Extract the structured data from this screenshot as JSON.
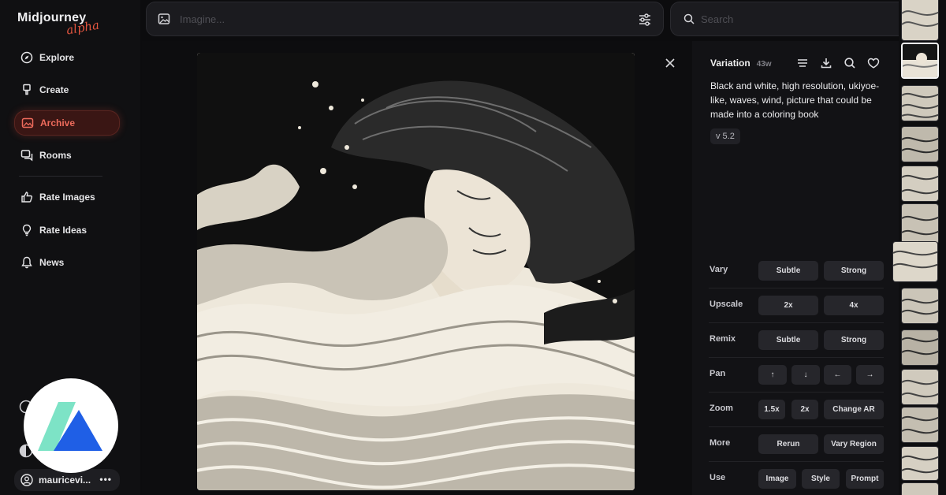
{
  "app": {
    "name": "Midjourney",
    "sub": "alpha"
  },
  "sidebar": {
    "items": [
      {
        "label": "Explore",
        "icon": "compass-icon"
      },
      {
        "label": "Create",
        "icon": "brush-icon"
      },
      {
        "label": "Archive",
        "icon": "image-icon",
        "active": true
      },
      {
        "label": "Rooms",
        "icon": "chat-icon"
      },
      {
        "label": "Rate Images",
        "icon": "thumbs-up-icon"
      },
      {
        "label": "Rate Ideas",
        "icon": "lightbulb-icon"
      },
      {
        "label": "News",
        "icon": "bell-icon"
      }
    ],
    "user": {
      "name": "mauricevi...",
      "more": "•••"
    }
  },
  "imagine": {
    "placeholder": "Imagine..."
  },
  "search": {
    "placeholder": "Search"
  },
  "panel": {
    "title": "Variation",
    "age": "43w",
    "prompt": "Black and white, high resolution, ukiyoe-like, waves, wind, picture that could be made into a coloring book",
    "version": "v 5.2",
    "actions": [
      {
        "label": "Vary",
        "buttons": [
          "Subtle",
          "Strong"
        ]
      },
      {
        "label": "Upscale",
        "buttons": [
          "2x",
          "4x"
        ]
      },
      {
        "label": "Remix",
        "buttons": [
          "Subtle",
          "Strong"
        ]
      },
      {
        "label": "Pan",
        "buttons": [
          "↑",
          "↓",
          "←",
          "→"
        ]
      },
      {
        "label": "Zoom",
        "buttons": [
          "1.5x",
          "2x",
          "Change AR"
        ]
      },
      {
        "label": "More",
        "buttons": [
          "Rerun",
          "Vary Region"
        ]
      },
      {
        "label": "Use",
        "buttons": [
          "Image",
          "Style",
          "Prompt"
        ]
      }
    ]
  },
  "colors": {
    "accent": "#ee6b5c",
    "background": "#0c0c0e",
    "panel": "#121215"
  }
}
